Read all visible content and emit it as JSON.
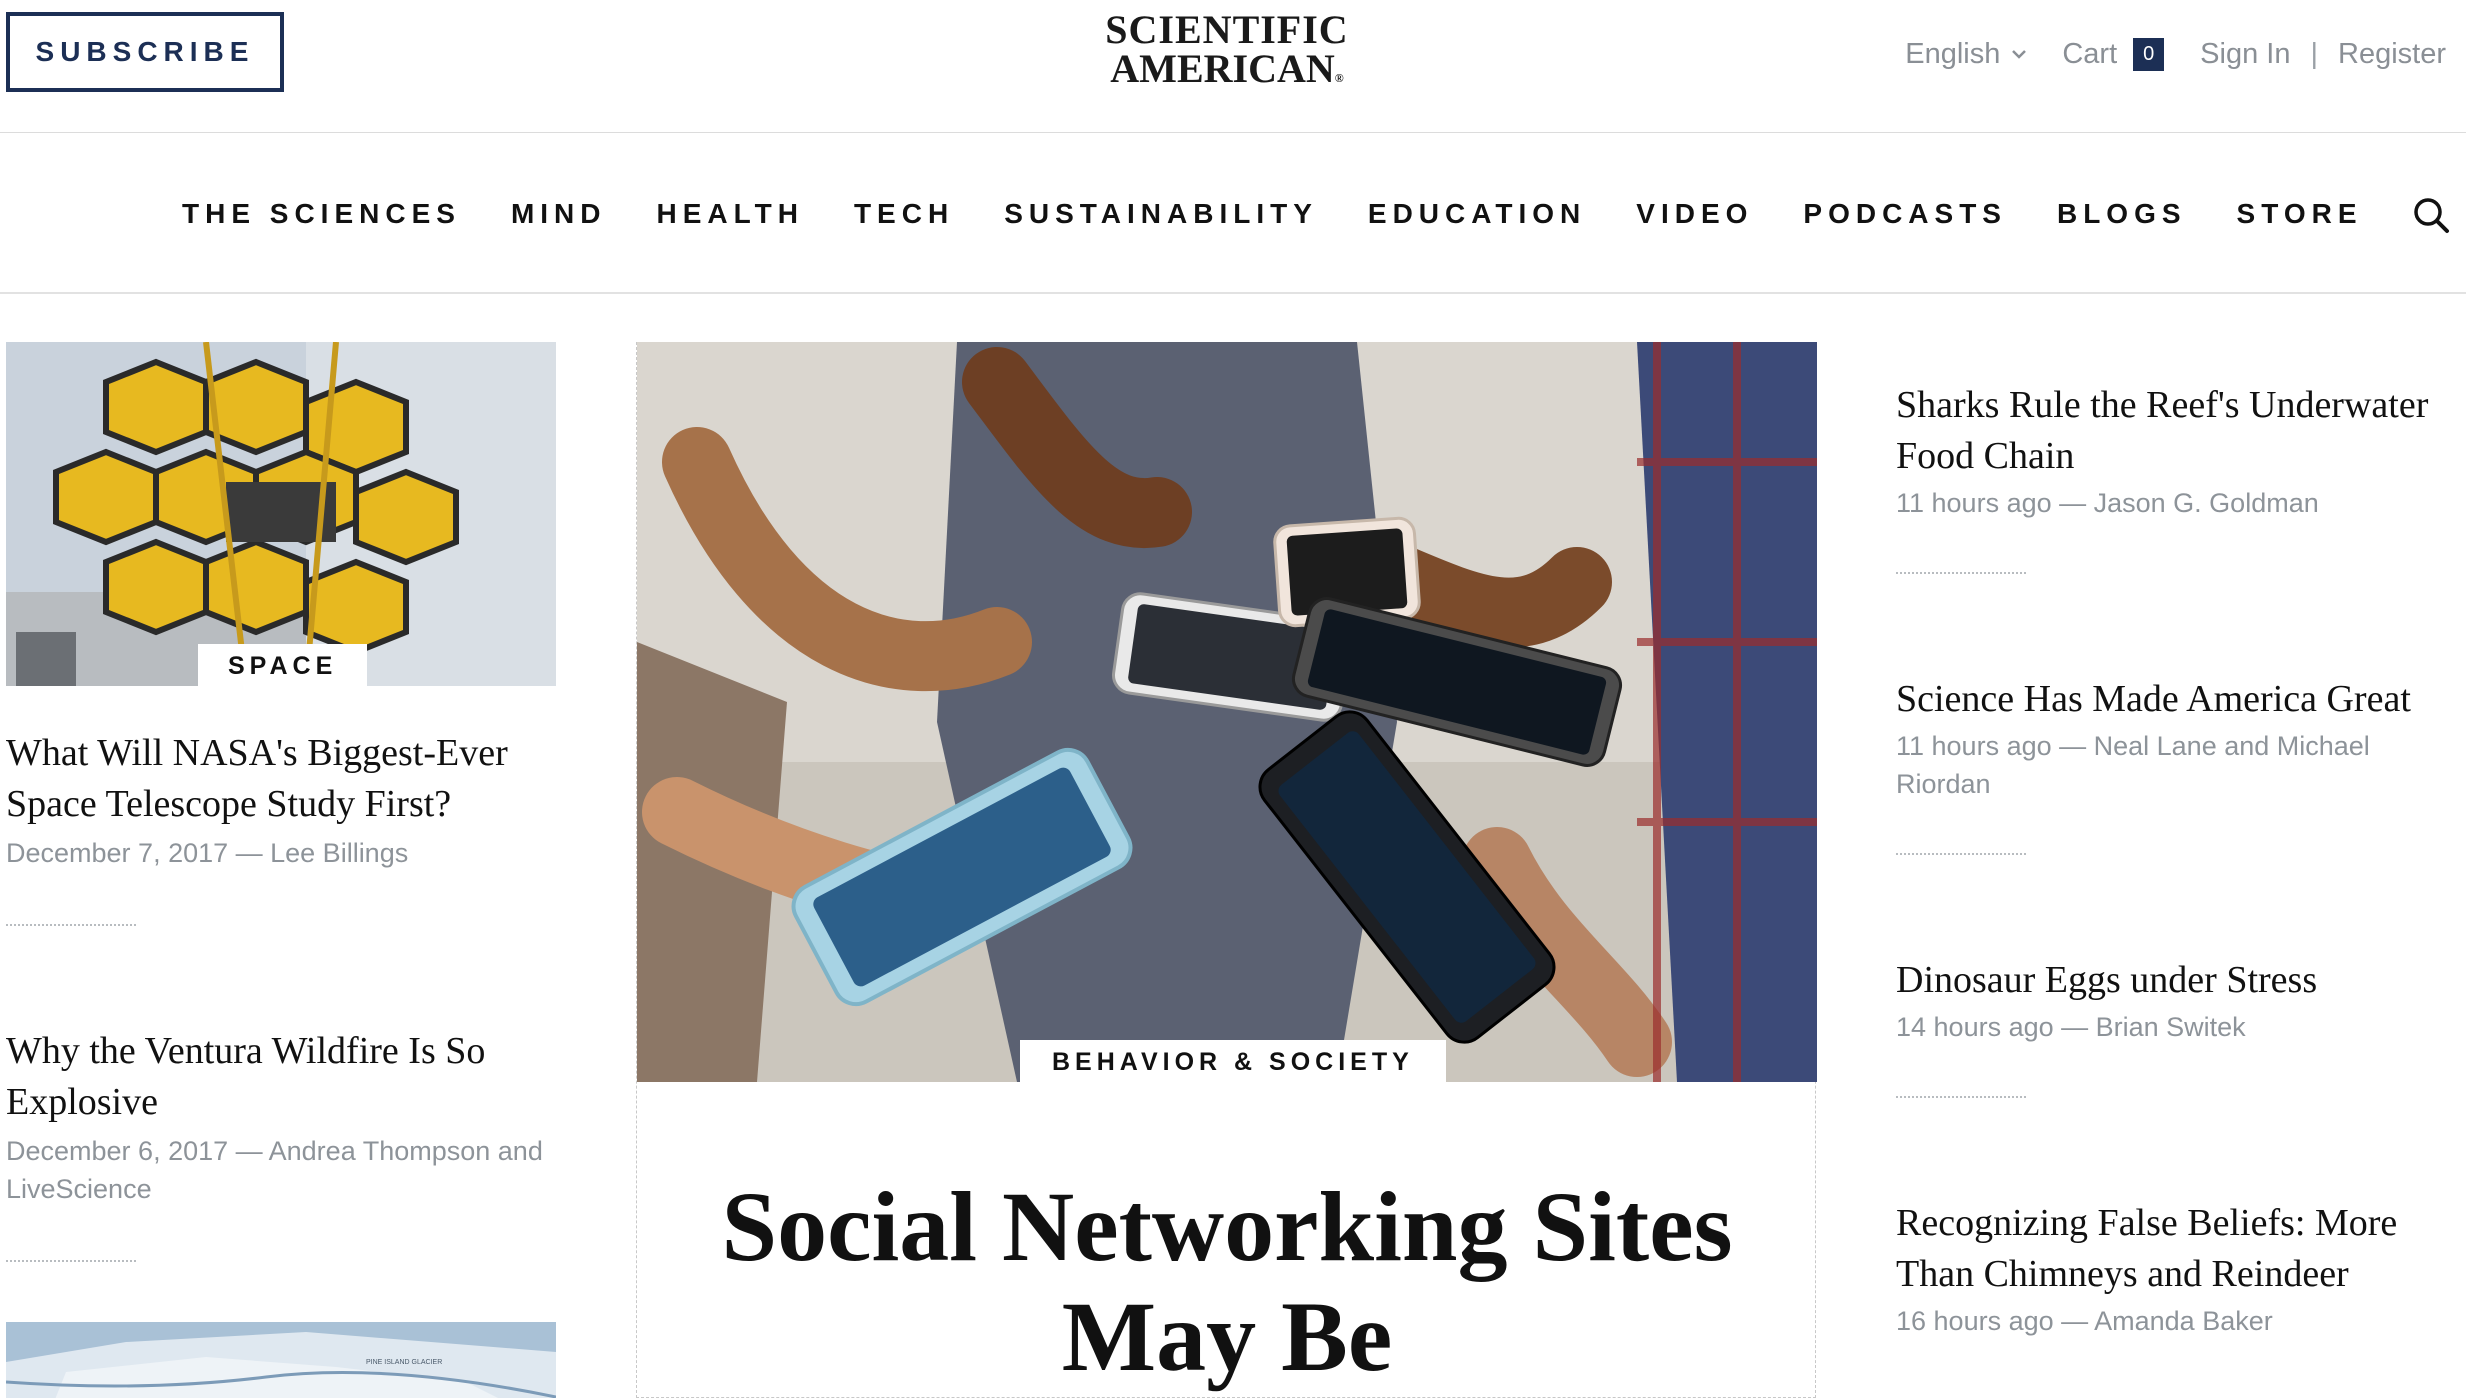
{
  "header": {
    "subscribe_label": "SUBSCRIBE",
    "logo_line1": "SCIENTIFIC",
    "logo_line2": "AMERICAN",
    "language": "English",
    "cart_label": "Cart",
    "cart_count": "0",
    "signin_label": "Sign In",
    "separator": "|",
    "register_label": "Register"
  },
  "nav": {
    "items": [
      "THE SCIENCES",
      "MIND",
      "HEALTH",
      "TECH",
      "SUSTAINABILITY",
      "EDUCATION",
      "VIDEO",
      "PODCASTS",
      "BLOGS",
      "STORE"
    ]
  },
  "left": {
    "story1": {
      "tag": "SPACE",
      "title": "What Will NASA's Biggest-Ever Space Telescope Study First?",
      "meta": "December 7, 2017 — Lee Billings"
    },
    "story2": {
      "title": "Why the Ventura Wildfire Is So Explosive",
      "meta": "December 6, 2017 — Andrea Thompson and LiveScience"
    },
    "map_labels": [
      "PINE ISLAND GLACIER"
    ]
  },
  "feature": {
    "tag": "BEHAVIOR & SOCIETY",
    "title": "Social Networking Sites May Be"
  },
  "right": {
    "stories": [
      {
        "title": "Sharks Rule the Reef's Underwater Food Chain",
        "meta": "11 hours ago — Jason G. Goldman"
      },
      {
        "title": "Science Has Made America Great",
        "meta": "11 hours ago — Neal Lane and Michael Riordan"
      },
      {
        "title": "Dinosaur Eggs under Stress",
        "meta": "14 hours ago — Brian Switek"
      },
      {
        "title": "Recognizing False Beliefs: More Than Chimneys and Reindeer",
        "meta": "16 hours ago — Amanda Baker"
      }
    ]
  },
  "colors": {
    "brand_navy": "#1c2f55",
    "meta_gray": "#8d9399",
    "telescope_gold": "#e7b920"
  }
}
